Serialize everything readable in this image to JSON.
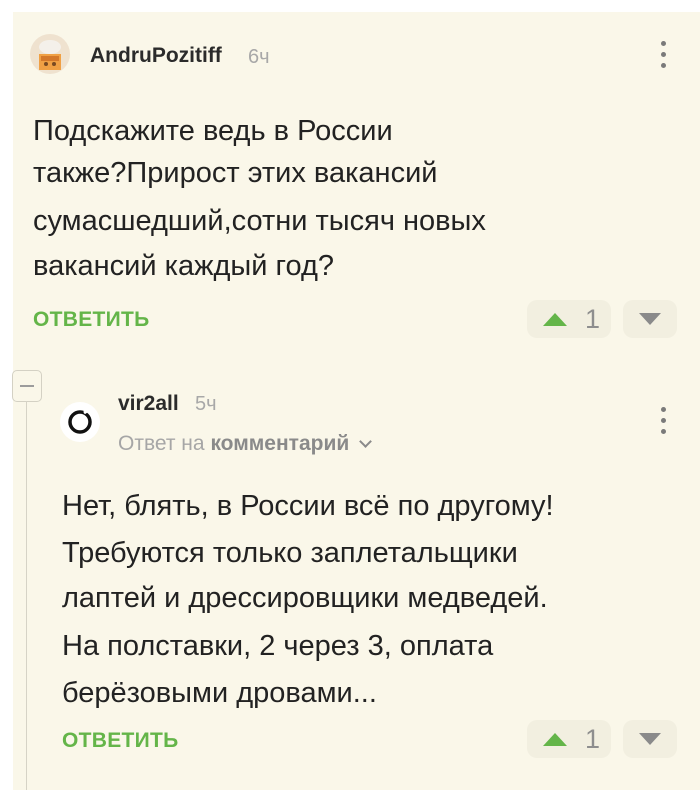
{
  "comment1": {
    "username": "AndruPozitiff",
    "time": "6ч",
    "text_lines": [
      "Подскажите ведь в России",
      "также?Прирост этих вакансий",
      "сумасшедший,сотни тысяч новых",
      "вакансий каждый год?"
    ],
    "reply_label": "ОТВЕТИТЬ",
    "rating": "1"
  },
  "comment2": {
    "username": "vir2all",
    "time": "5ч",
    "reply_to_prefix": "Ответ на",
    "reply_to_target": "комментарий",
    "text_lines": [
      "Нет, блять, в России всё по другому!",
      "Требуются только заплетальщики",
      "лаптей и дрессировщики медведей.",
      "На полставки, 2 через 3, оплата",
      "берёзовыми дровами..."
    ],
    "reply_label": "ОТВЕТИТЬ",
    "rating": "1"
  },
  "colors": {
    "background": "#faf7e9",
    "accent_green": "#64b549",
    "text": "#222222",
    "muted": "#a8a8a8"
  },
  "icons": {
    "kebab": "more-vertical-icon",
    "upvote": "triangle-up-icon",
    "downvote": "triangle-down-icon",
    "collapse": "minus-icon",
    "expand_reply": "chevron-down-icon"
  }
}
